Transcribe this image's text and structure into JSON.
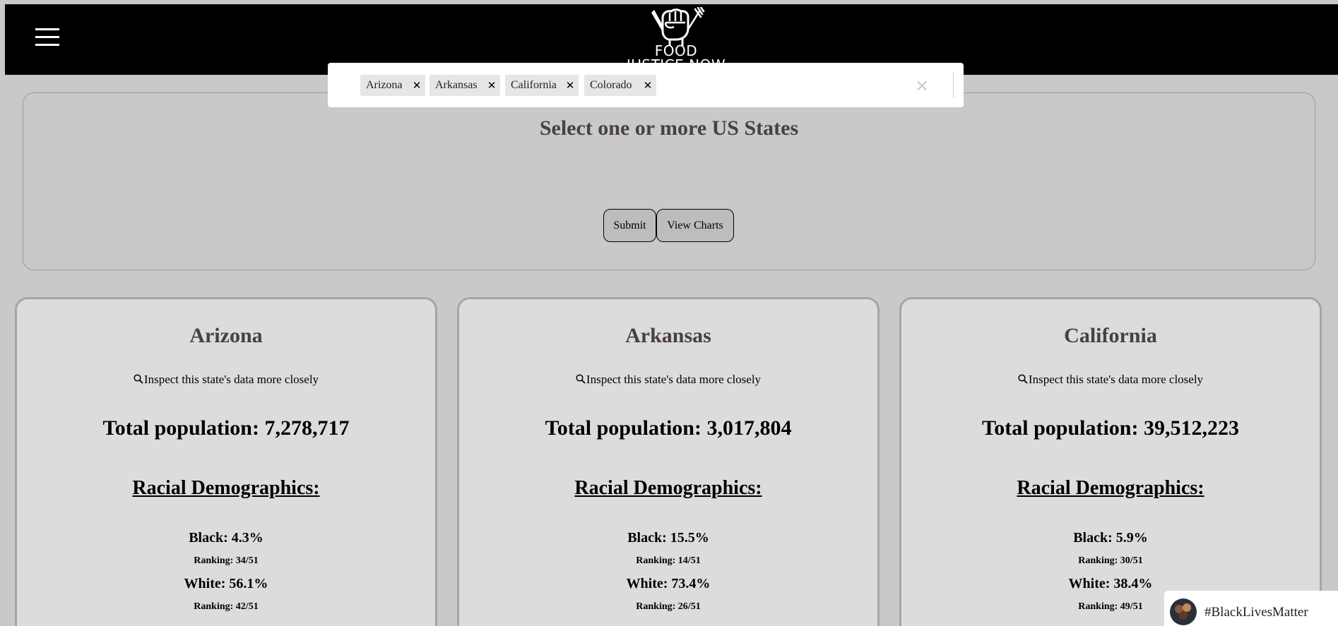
{
  "brand": {
    "line1": "FOOD",
    "line2": "JUSTICE NOW"
  },
  "icons": {
    "menu": "hamburger-menu-icon",
    "logo": "raised-fist-fork-knife-icon",
    "magnifier": "search-icon",
    "remove": "close-icon",
    "clear": "clear-all-icon",
    "dropdown": "chevron-down-icon"
  },
  "selector": {
    "title": "Select one or more US States",
    "selected": [
      "Arizona",
      "Arkansas",
      "California",
      "Colorado"
    ],
    "chip_remove_glyph": "✕",
    "clear_glyph": "×",
    "submit_label": "Submit",
    "view_charts_label": "View Charts"
  },
  "cards": [
    {
      "state": "Arizona",
      "inspect_label": "Inspect this state's data more closely",
      "total_population": "Total population: 7,278,717",
      "racial_heading": "Racial Demographics:",
      "black": "Black: 4.3%",
      "black_rank": "Ranking: 34/51",
      "white": "White: 56.1%",
      "white_rank": "Ranking: 42/51"
    },
    {
      "state": "Arkansas",
      "inspect_label": "Inspect this state's data more closely",
      "total_population": "Total population: 3,017,804",
      "racial_heading": "Racial Demographics:",
      "black": "Black: 15.5%",
      "black_rank": "Ranking: 14/51",
      "white": "White: 73.4%",
      "white_rank": "Ranking: 26/51"
    },
    {
      "state": "California",
      "inspect_label": "Inspect this state's data more closely",
      "total_population": "Total population: 39,512,223",
      "racial_heading": "Racial Demographics:",
      "black": "Black: 5.9%",
      "black_rank": "Ranking: 30/51",
      "white": "White: 38.4%",
      "white_rank": "Ranking: 49/51"
    }
  ],
  "badge": {
    "text": "#BlackLivesMatter"
  },
  "colors": {
    "background": "#c9c9c9",
    "navbar": "#000000",
    "card": "#dcdcdc",
    "title_text": "#4a4040"
  }
}
